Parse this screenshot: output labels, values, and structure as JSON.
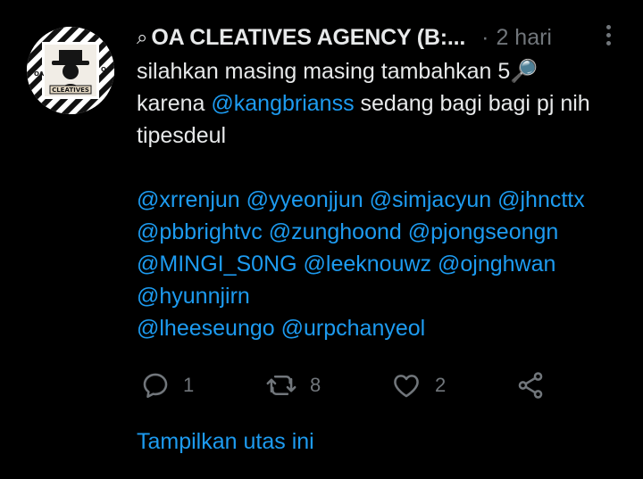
{
  "tweet": {
    "author_icon": "magnifier-icon",
    "author_prefix": "⌕",
    "author_name": "OA CLEATIVES AGENCY (B:...",
    "separator": "·",
    "time": "2 hari",
    "avatar_text": "CLEATIVES",
    "avatar_corner_left": "OA",
    "avatar_corner_right": "OA",
    "lines": [
      {
        "parts": [
          {
            "t": "silahkan masing masing tambahkan 5"
          },
          {
            "emoji": "🔎"
          }
        ]
      },
      {
        "parts": [
          {
            "t": "karena "
          },
          {
            "m": "@kangbrianss"
          },
          {
            "t": " sedang bagi bagi pj nih"
          }
        ]
      },
      {
        "parts": [
          {
            "t": "tipesdeul"
          }
        ]
      },
      {
        "parts": []
      },
      {
        "parts": [
          {
            "m": "@xrrenjun"
          },
          {
            "t": " "
          },
          {
            "m": "@yyeonjjun"
          },
          {
            "t": " "
          },
          {
            "m": "@simjacyun"
          },
          {
            "t": " "
          },
          {
            "m": "@jhncttx"
          }
        ]
      },
      {
        "parts": [
          {
            "m": "@pbbrightvc"
          },
          {
            "t": " "
          },
          {
            "m": "@zunghoond"
          },
          {
            "t": " "
          },
          {
            "m": "@pjongseongn"
          }
        ]
      },
      {
        "parts": [
          {
            "m": "@MINGI_S0NG"
          },
          {
            "t": " "
          },
          {
            "m": "@leeknouwz"
          },
          {
            "t": " "
          },
          {
            "m": "@ojnghwan"
          }
        ]
      },
      {
        "parts": [
          {
            "m": "@hyunnjirn"
          }
        ]
      },
      {
        "parts": [
          {
            "m": "@lheeseungo"
          },
          {
            "t": " "
          },
          {
            "m": "@urpchanyeol"
          }
        ]
      }
    ],
    "actions": {
      "reply": {
        "icon": "reply-icon",
        "count": "1"
      },
      "retweet": {
        "icon": "retweet-icon",
        "count": "8"
      },
      "like": {
        "icon": "heart-icon",
        "count": "2"
      },
      "share": {
        "icon": "share-icon"
      }
    },
    "show_thread": "Tampilkan utas ini",
    "colors": {
      "background": "#000000",
      "text": "#e7e9ea",
      "muted": "#71767b",
      "accent": "#1d9bf0"
    }
  }
}
